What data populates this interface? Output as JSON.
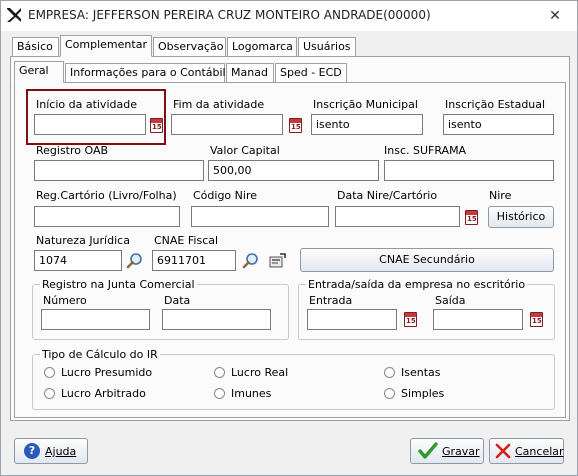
{
  "window": {
    "title": "EMPRESA: JEFFERSON PEREIRA CRUZ MONTEIRO ANDRADE(00000)"
  },
  "main_tabs": [
    {
      "label": "Básico"
    },
    {
      "label": "Complementar"
    },
    {
      "label": "Observação"
    },
    {
      "label": "Logomarca"
    },
    {
      "label": "Usuários"
    }
  ],
  "sub_tabs": [
    {
      "label": "Geral"
    },
    {
      "label": "Informações para o Contábil"
    },
    {
      "label": "Manad"
    },
    {
      "label": "Sped - ECD"
    }
  ],
  "calendar_icon_text": "15",
  "fields": {
    "inicio_atividade": {
      "label": "Início da atividade",
      "value": ""
    },
    "fim_atividade": {
      "label": "Fim da atividade",
      "value": ""
    },
    "inscricao_municipal": {
      "label": "Inscrição Municipal",
      "value": "isento"
    },
    "inscricao_estadual": {
      "label": "Inscrição Estadual",
      "value": "isento"
    },
    "registro_oab": {
      "label": "Registro OAB",
      "value": ""
    },
    "valor_capital": {
      "label": "Valor Capital",
      "value": "500,00"
    },
    "insc_suframa": {
      "label": "Insc. SUFRAMA",
      "value": ""
    },
    "reg_cartorio": {
      "label": "Reg.Cartório (Livro/Folha)",
      "value": ""
    },
    "codigo_nire": {
      "label": "Código Nire",
      "value": ""
    },
    "data_nire": {
      "label": "Data Nire/Cartório",
      "value": ""
    },
    "nire": {
      "label": "Nire",
      "button": "Histórico"
    },
    "natureza_juridica": {
      "label": "Natureza Jurídica",
      "value": "1074"
    },
    "cnae_fiscal": {
      "label": "CNAE Fiscal",
      "value": "6911701"
    },
    "cnae_secundario_button": "CNAE Secundário"
  },
  "registro_junta": {
    "legend": "Registro na Junta Comercial",
    "numero_label": "Número",
    "numero_value": "",
    "data_label": "Data",
    "data_value": ""
  },
  "entrada_saida": {
    "legend": "Entrada/saída da empresa no escritório",
    "entrada_label": "Entrada",
    "entrada_value": "",
    "saida_label": "Saída",
    "saida_value": ""
  },
  "calculo_ir": {
    "legend": "Tipo de Cálculo do IR",
    "options": [
      {
        "label": "Lucro Presumido"
      },
      {
        "label": "Lucro Real"
      },
      {
        "label": "Isentas"
      },
      {
        "label": "Lucro Arbitrado"
      },
      {
        "label": "Imunes"
      },
      {
        "label": "Simples"
      }
    ]
  },
  "footer": {
    "help_label": "Ajuda",
    "save_label": "Gravar",
    "cancel_label": "Cancelar"
  },
  "colors": {
    "highlight_border": "#7a1015",
    "save_check": "#2e9a2e",
    "cancel_x": "#d42020",
    "help_icon": "#2a5bb8"
  }
}
